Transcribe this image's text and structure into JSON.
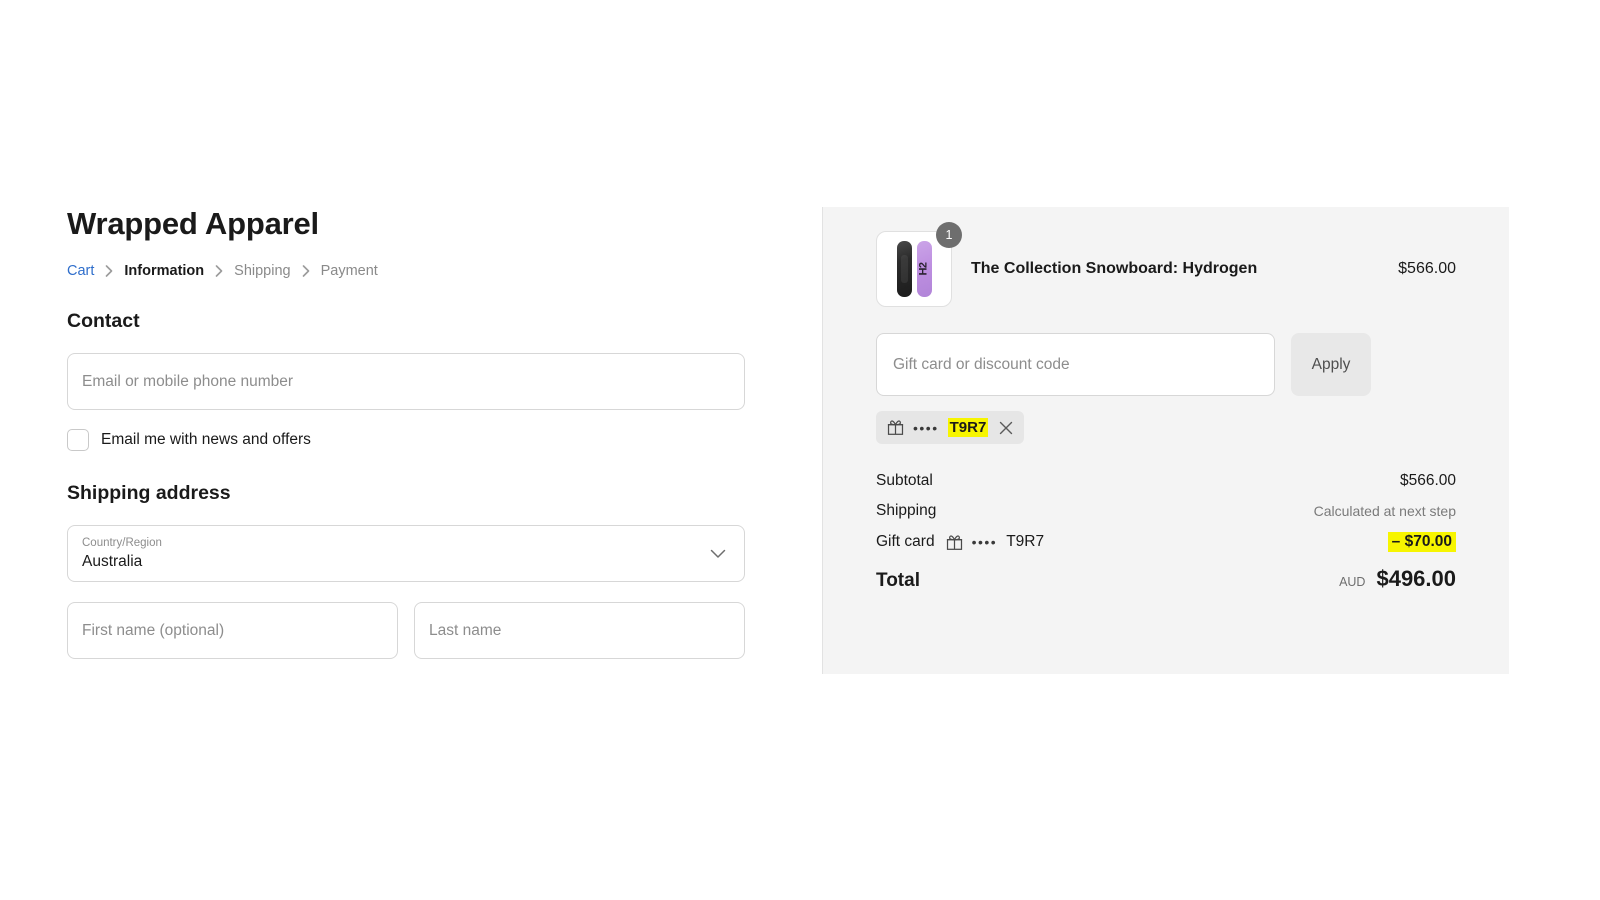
{
  "shop": {
    "title": "Wrapped Apparel"
  },
  "breadcrumb": {
    "items": [
      {
        "label": "Cart",
        "state": "link"
      },
      {
        "label": "Information",
        "state": "current"
      },
      {
        "label": "Shipping",
        "state": "upcoming"
      },
      {
        "label": "Payment",
        "state": "upcoming"
      }
    ],
    "separator_icon": "chevron-right-icon"
  },
  "contact": {
    "heading": "Contact",
    "email_placeholder": "Email or mobile phone number",
    "email_value": "",
    "newsletter_label": "Email me with news and offers",
    "newsletter_checked": false
  },
  "shipping_address": {
    "heading": "Shipping address",
    "country": {
      "label": "Country/Region",
      "value": "Australia",
      "chevron_icon": "chevron-down-icon"
    },
    "first_name_placeholder": "First name (optional)",
    "first_name_value": "",
    "last_name_placeholder": "Last name",
    "last_name_value": ""
  },
  "summary": {
    "product": {
      "name": "The Collection Snowboard: Hydrogen",
      "price": "$566.00",
      "quantity": "1",
      "thumb_label": "H2",
      "thumb_icon": "snowboard-pair-thumbnail"
    },
    "discount": {
      "placeholder": "Gift card or discount code",
      "value": "",
      "apply_label": "Apply"
    },
    "applied_code": {
      "gift_icon": "gift-icon",
      "dots": "••••",
      "code": "T9R7",
      "remove_icon": "close-icon"
    },
    "totals": [
      {
        "label": "Subtotal",
        "value": "$566.00",
        "style": "normal"
      },
      {
        "label": "Shipping",
        "value": "Calculated at next step",
        "style": "muted"
      }
    ],
    "gift_card_line": {
      "label": "Gift card",
      "gift_icon": "gift-icon",
      "dots": "••••",
      "code": "T9R7",
      "amount": "– $70.00"
    },
    "total": {
      "label": "Total",
      "currency": "AUD",
      "value": "$496.00"
    }
  },
  "colors": {
    "link": "#2f6ecb",
    "panel_bg": "#f4f4f4",
    "highlight": "#f7f500",
    "badge": "#6e6e6e",
    "apply_btn": "#e8e8e8"
  }
}
